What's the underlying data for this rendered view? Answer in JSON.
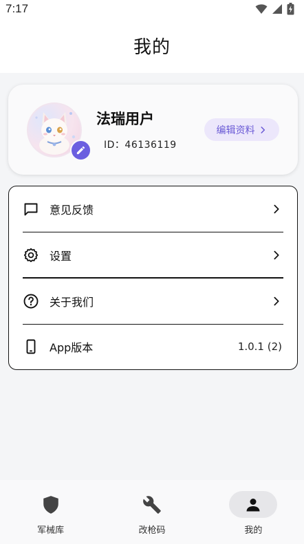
{
  "status_bar": {
    "time": "7:17"
  },
  "header": {
    "title": "我的"
  },
  "profile": {
    "username": "法瑞用户",
    "id_text": "ID：46136119",
    "edit_label": "编辑资料"
  },
  "menu": {
    "items": [
      {
        "label": "意见反馈",
        "icon": "chat-bubble-icon"
      },
      {
        "label": "设置",
        "icon": "gear-icon"
      },
      {
        "label": "关于我们",
        "icon": "help-circle-icon"
      },
      {
        "label": "App版本",
        "value": "1.0.1 (2)",
        "icon": "phone-icon"
      }
    ]
  },
  "bottom_nav": {
    "items": [
      {
        "label": "军械库",
        "icon": "shield-icon"
      },
      {
        "label": "改枪码",
        "icon": "wrench-icon"
      },
      {
        "label": "我的",
        "icon": "person-icon",
        "active": true
      }
    ]
  },
  "colors": {
    "accent": "#6b5fe0",
    "edit_button_bg": "#ece7fb",
    "page_bg": "#f4f5f7"
  }
}
